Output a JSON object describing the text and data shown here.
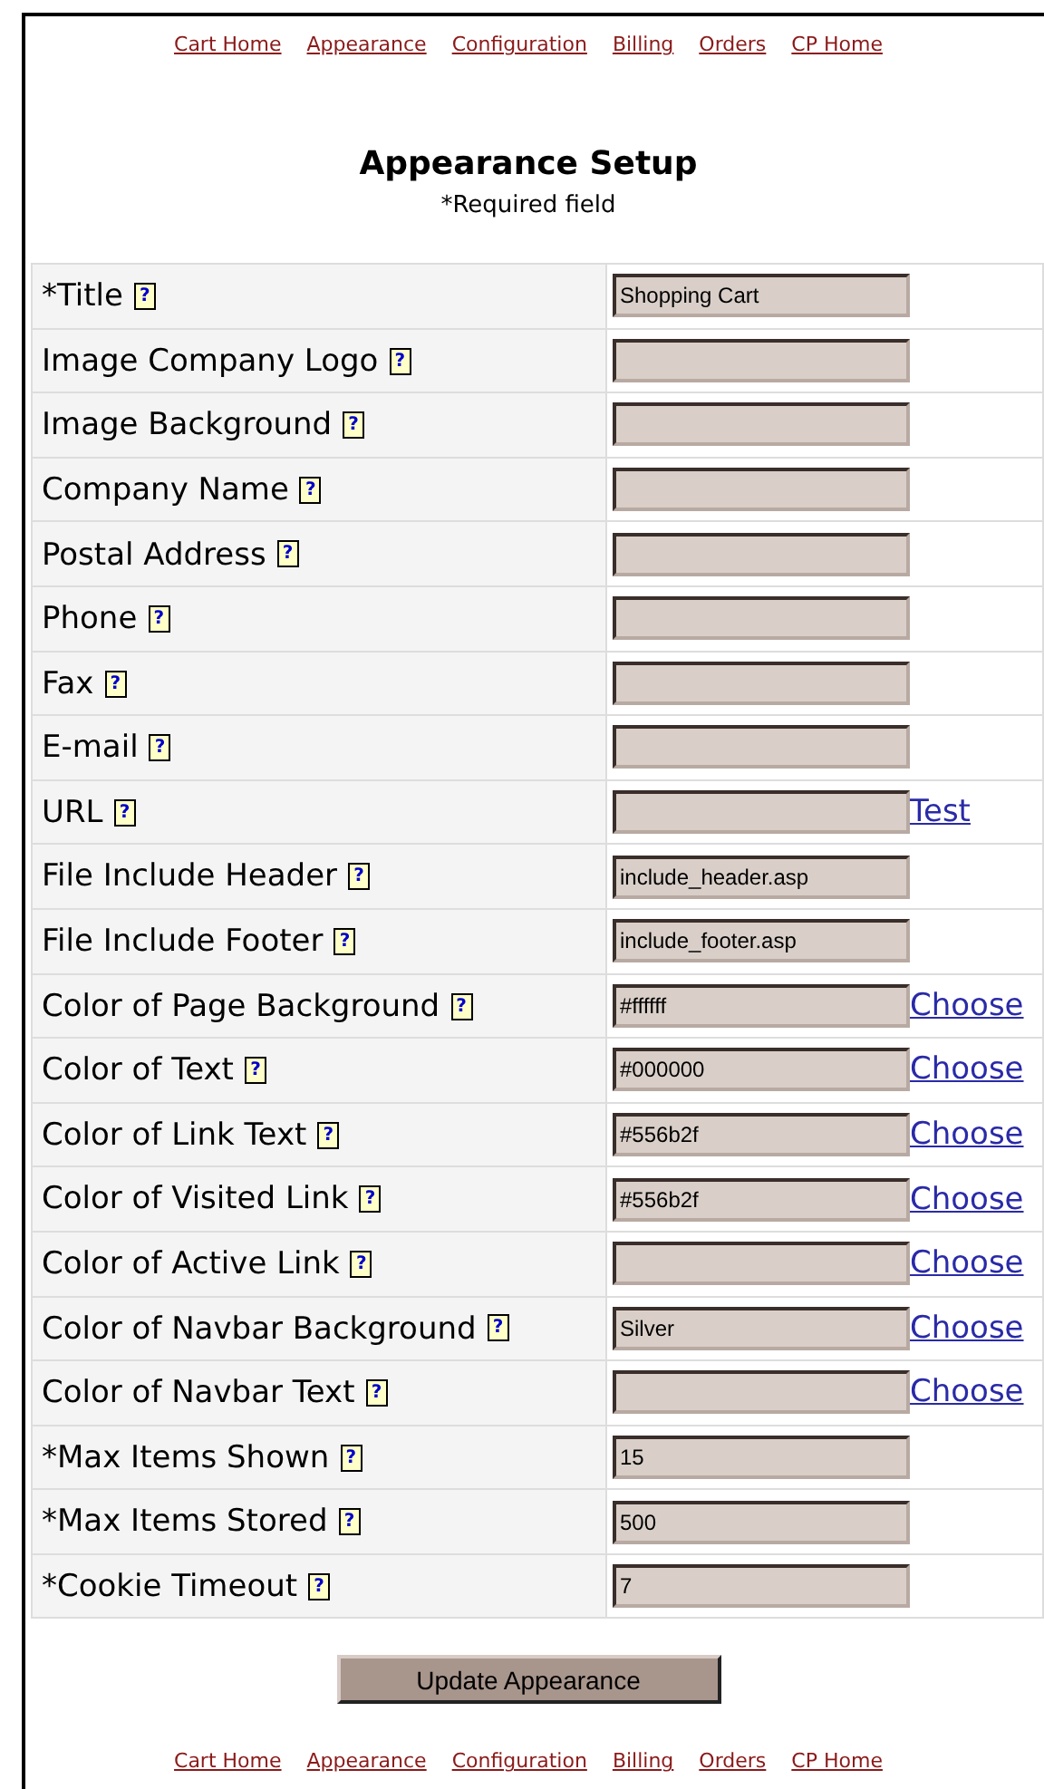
{
  "nav_top": [
    "Cart Home",
    "Appearance",
    "Configuration",
    "Billing",
    "Orders",
    "CP Home"
  ],
  "heading": "Appearance Setup",
  "note": "*Required field",
  "rows": [
    {
      "label": "*Title",
      "help": "?",
      "value": "Shopping Cart"
    },
    {
      "label": "Image Company Logo",
      "help": "?"
    },
    {
      "label": "Image Background",
      "help": "?"
    },
    {
      "label": "Company Name",
      "help": "?"
    },
    {
      "label": "Postal Address",
      "help": "?"
    },
    {
      "label": "Phone",
      "help": "?"
    },
    {
      "label": "Fax",
      "help": "?"
    },
    {
      "label": "E-mail",
      "help": "?"
    },
    {
      "label": "URL",
      "help": "?",
      "link": "Test"
    },
    {
      "label": "File Include Header",
      "help": "?",
      "value": "include_header.asp"
    },
    {
      "label": "File Include Footer",
      "help": "?",
      "value": "include_footer.asp"
    },
    {
      "label": "Color of Page Background",
      "help": "?",
      "value": "#ffffff",
      "link": "Choose"
    },
    {
      "label": "Color of Text",
      "help": "?",
      "value": "#000000",
      "link": "Choose"
    },
    {
      "label": "Color of Link Text",
      "help": "?",
      "value": "#556b2f",
      "link": "Choose"
    },
    {
      "label": "Color of Visited Link",
      "help": "?",
      "value": "#556b2f",
      "link": "Choose"
    },
    {
      "label": "Color of Active Link",
      "help": "?",
      "link": "Choose"
    },
    {
      "label": "Color of Navbar Background",
      "help": "?",
      "value": "Silver",
      "link": "Choose"
    },
    {
      "label": "Color of Navbar Text",
      "help": "?",
      "link": "Choose"
    },
    {
      "label": "*Max Items Shown",
      "help": "?",
      "value": "15"
    },
    {
      "label": "*Max Items Stored",
      "help": "?",
      "value": "500"
    },
    {
      "label": "*Cookie Timeout",
      "help": "?",
      "value": "7"
    }
  ],
  "submit": "Update Appearance",
  "nav_bottom": [
    "Cart Home",
    "Appearance",
    "Configuration",
    "Billing",
    "Orders",
    "CP Home"
  ]
}
